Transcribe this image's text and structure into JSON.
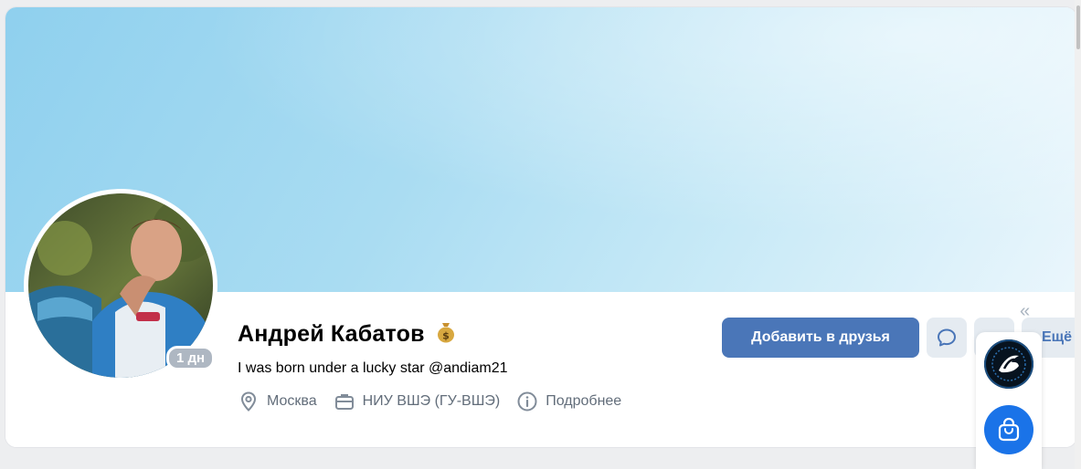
{
  "profile": {
    "name": "Андрей Кабатов",
    "status": "I was born under a lucky star @andiam21",
    "online_badge": "1 дн",
    "city": "Москва",
    "education": "НИУ ВШЭ (ГУ-ВШЭ)",
    "more_info": "Подробнее"
  },
  "actions": {
    "add_friend": "Добавить в друзья",
    "more": "Ещё"
  },
  "icons": {
    "money_bag": "money-bag-icon",
    "location": "location-pin-icon",
    "work": "briefcase-icon",
    "info": "info-icon",
    "message": "chat-bubble-icon",
    "gift": "gift-icon",
    "collapse": "double-chevron-left-icon",
    "app": "app-logo-icon",
    "shop": "shopping-bag-icon"
  },
  "colors": {
    "accent": "#4a76b8",
    "button_secondary": "#e5ebf1",
    "muted_text": "#626d7a",
    "badge": "#aeb7c2",
    "shop_blue": "#1a73e8"
  }
}
